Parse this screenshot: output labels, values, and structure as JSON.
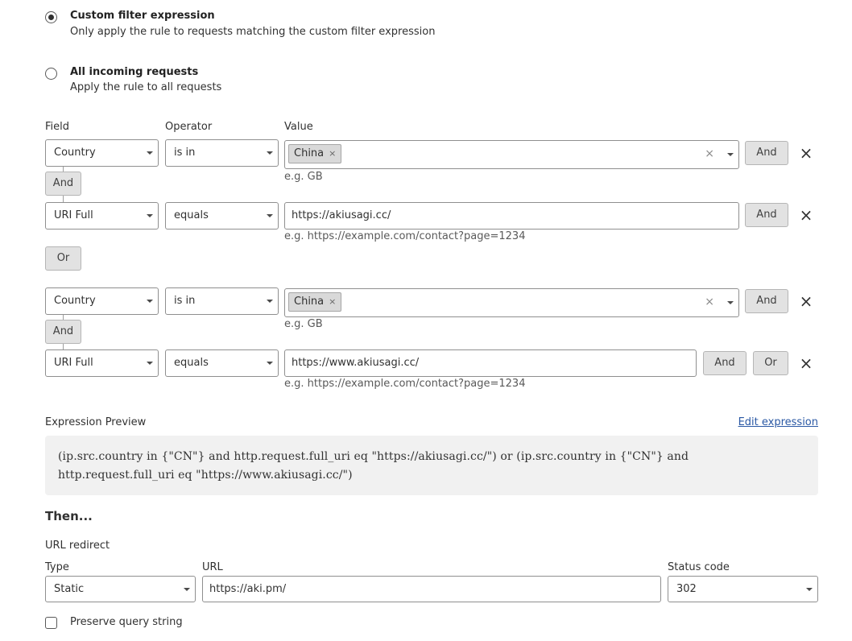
{
  "filter_options": [
    {
      "title": "Custom filter expression",
      "description": "Only apply the rule to requests matching the custom filter expression",
      "selected": true
    },
    {
      "title": "All incoming requests",
      "description": "Apply the rule to all requests",
      "selected": false
    }
  ],
  "columns": {
    "field": "Field",
    "operator": "Operator",
    "value": "Value"
  },
  "rows": [
    {
      "field": "Country",
      "operator": "is in",
      "tag": "China",
      "tag_remove": "×",
      "clear": "×",
      "hint": "e.g. GB",
      "and_label": "And",
      "remove": "×"
    },
    {
      "field": "URI Full",
      "operator": "equals",
      "value": "https://akiusagi.cc/",
      "hint": "e.g. https://example.com/contact?page=1234",
      "and_label": "And",
      "remove": "×"
    },
    {
      "field": "Country",
      "operator": "is in",
      "tag": "China",
      "tag_remove": "×",
      "clear": "×",
      "hint": "e.g. GB",
      "and_label": "And",
      "remove": "×"
    },
    {
      "field": "URI Full",
      "operator": "equals",
      "value": "https://www.akiusagi.cc/",
      "hint": "e.g. https://example.com/contact?page=1234",
      "and_label": "And",
      "or_label": "Or",
      "remove": "×"
    }
  ],
  "group_and_label": "And",
  "group_or_label": "Or",
  "expression_preview": {
    "title": "Expression Preview",
    "edit_link": "Edit expression",
    "line1": "(ip.src.country in {\"CN\"} and http.request.full_uri eq \"https://akiusagi.cc/\") or (ip.src.country in {\"CN\"} and",
    "line2": "http.request.full_uri eq \"https://www.akiusagi.cc/\")"
  },
  "then": {
    "title": "Then...",
    "action": "URL redirect",
    "type_label": "Type",
    "type_value": "Static",
    "url_label": "URL",
    "url_value": "https://aki.pm/",
    "status_label": "Status code",
    "status_value": "302",
    "preserve_query": "Preserve query string",
    "preserve_checked": false
  }
}
